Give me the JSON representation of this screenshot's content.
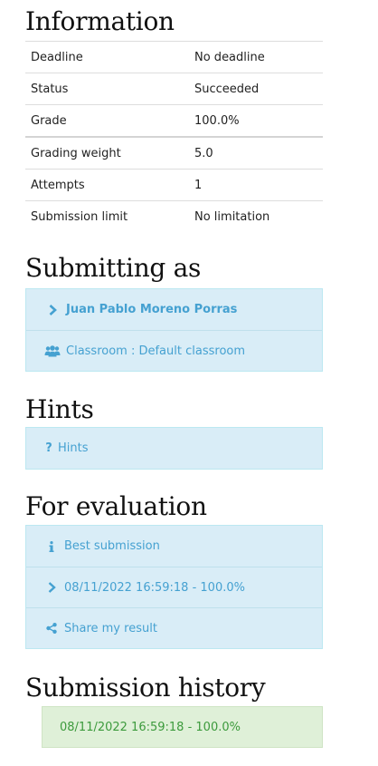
{
  "information": {
    "title": "Information",
    "rows": [
      {
        "label": "Deadline",
        "value": "No deadline"
      },
      {
        "label": "Status",
        "value": "Succeeded"
      },
      {
        "label": "Grade",
        "value": "100.0%"
      },
      {
        "label": "Grading weight",
        "value": "5.0"
      },
      {
        "label": "Attempts",
        "value": "1"
      },
      {
        "label": "Submission limit",
        "value": "No limitation"
      }
    ]
  },
  "submitting_as": {
    "title": "Submitting as",
    "user": "Juan Pablo Moreno Porras",
    "classroom": "Classroom : Default classroom",
    "user_icon": "chevron-right-icon",
    "classroom_icon": "users-icon"
  },
  "hints": {
    "title": "Hints",
    "label": "Hints",
    "icon": "question-icon"
  },
  "evaluation": {
    "title": "For evaluation",
    "best_label": "Best submission",
    "best_entry": "08/11/2022 16:59:18 - 100.0%",
    "share_label": "Share my result",
    "icons": [
      "info-icon",
      "chevron-right-icon",
      "share-icon"
    ]
  },
  "history": {
    "title": "Submission history",
    "entries": [
      "08/11/2022 16:59:18 - 100.0%"
    ]
  },
  "colors": {
    "panel_bg": "#d9edf7",
    "panel_text": "#45a1d1",
    "success_bg": "#dff0d8",
    "success_text": "#3c9a3c"
  }
}
